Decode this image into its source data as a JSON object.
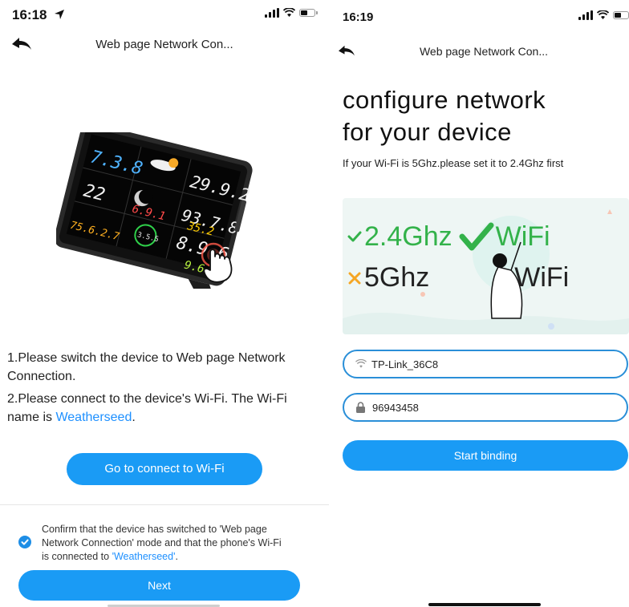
{
  "left": {
    "status": {
      "time": "16:18"
    },
    "nav": {
      "title": "Web page Network Con..."
    },
    "device": {
      "readouts": [
        "7.3.8",
        "29.9.2",
        "22",
        "93.7.8",
        "6.9.1",
        "35.2",
        "75.6.2.7",
        "8.9.6",
        "3.5.5",
        "9.6"
      ]
    },
    "instructions": {
      "step1": "1.Please switch the device to Web page Network Connection.",
      "step2_prefix": "2.Please connect to the device's Wi-Fi. The Wi-Fi name is ",
      "step2_ssid": "Weatherseed",
      "step2_suffix": "."
    },
    "connect_button": "Go to connect to Wi-Fi",
    "confirm": {
      "prefix": "Confirm that the device has switched to 'Web page Network Connection' mode and that the phone's Wi-Fi is connected to ",
      "ssid": "'Weatherseed'",
      "suffix": "."
    },
    "next_button": "Next"
  },
  "right": {
    "status": {
      "time": "16:19"
    },
    "nav": {
      "title": "Web page Network Con..."
    },
    "heading_line1": "configure network",
    "heading_line2": "for your device",
    "subtitle": "If your Wi-Fi is 5Ghz.please set it to 2.4Ghz first",
    "illustration": {
      "row1_band": "2.4Ghz",
      "row1_wifi": "WiFi",
      "row2_band": "5Ghz",
      "row2_wifi": "WiFi"
    },
    "wifi_field": {
      "value": "TP-Link_36C8",
      "icon": "wifi-icon"
    },
    "password_field": {
      "value": "96943458",
      "icon": "lock-icon"
    },
    "start_button": "Start binding"
  },
  "colors": {
    "accent": "#1a9bf5",
    "link": "#1e90ff",
    "ok_green": "#33b24a",
    "bad_orange": "#f5a623",
    "field_border": "#2a8fd8"
  }
}
